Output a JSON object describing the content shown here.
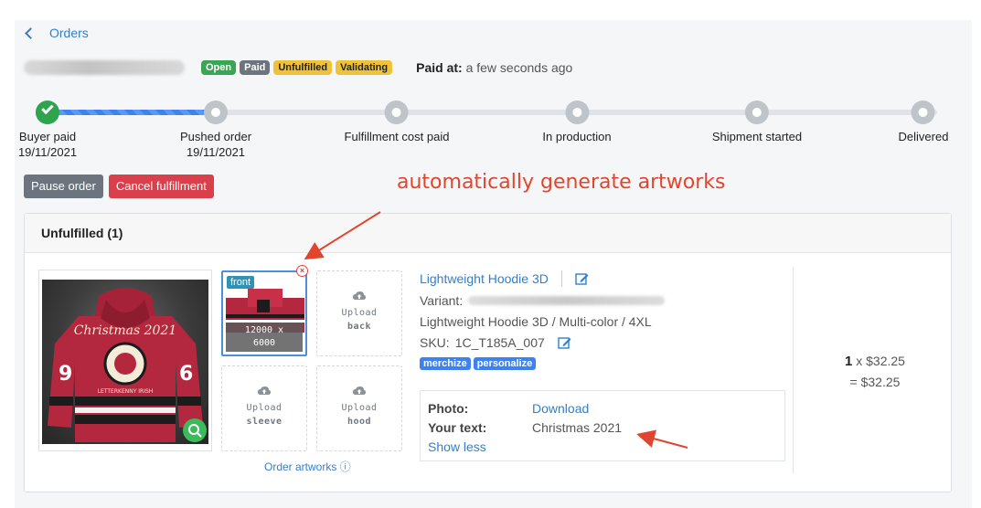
{
  "nav": {
    "back_label": "Orders"
  },
  "order": {
    "badges": [
      "Open",
      "Paid",
      "Unfulfilled",
      "Validating"
    ],
    "paid_at_label": "Paid at:",
    "paid_at_value": "a few seconds ago"
  },
  "progress": {
    "steps": [
      {
        "label": "Buyer paid",
        "date": "19/11/2021",
        "state": "done"
      },
      {
        "label": "Pushed order",
        "date": "19/11/2021",
        "state": "pending"
      },
      {
        "label": "Fulfillment cost paid",
        "date": "",
        "state": "pending"
      },
      {
        "label": "In production",
        "date": "",
        "state": "pending"
      },
      {
        "label": "Shipment started",
        "date": "",
        "state": "pending"
      },
      {
        "label": "Delivered",
        "date": "",
        "state": "pending"
      }
    ],
    "completed_fraction": 0.2
  },
  "actions": {
    "pause_label": "Pause order",
    "cancel_label": "Cancel fulfillment"
  },
  "annotations": {
    "top": "automatically generate artworks"
  },
  "fulfillment": {
    "header": "Unfulfilled (1)",
    "artworks": {
      "front": {
        "label": "front",
        "size_line1": "12000 x",
        "size_line2": "6000"
      },
      "back": {
        "line1": "Upload",
        "line2": "back"
      },
      "sleeve": {
        "line1": "Upload",
        "line2": "sleeve"
      },
      "hood": {
        "line1": "Upload",
        "line2": "hood"
      },
      "order_artworks_label": "Order artworks ⓘ"
    },
    "product": {
      "title": "Lightweight Hoodie 3D",
      "variant_label": "Variant:",
      "variant_desc": "Lightweight Hoodie 3D / Multi-color / 4XL",
      "sku_label": "SKU:",
      "sku_value": "1C_T185A_007",
      "tags": [
        "merchize",
        "personalize"
      ],
      "hoodie_text_front": "Christmas 2021",
      "hoodie_text_patch": "LETTERKENNY IRISH",
      "hoodie_numbers": [
        "9",
        "6"
      ]
    },
    "personalization": {
      "photo_label": "Photo:",
      "photo_value": "Download",
      "text_label": "Your text:",
      "text_value": "Christmas 2021",
      "toggle_label": "Show less"
    },
    "price": {
      "quantity": "1",
      "unit": "x $32.25",
      "total": "= $32.25"
    }
  },
  "colors": {
    "accent": "#2f7fd1",
    "success": "#2ea44f",
    "danger": "#d9404b",
    "warning": "#f0c23a",
    "annotation": "#e2452d",
    "hoodie": "#b3273f"
  }
}
